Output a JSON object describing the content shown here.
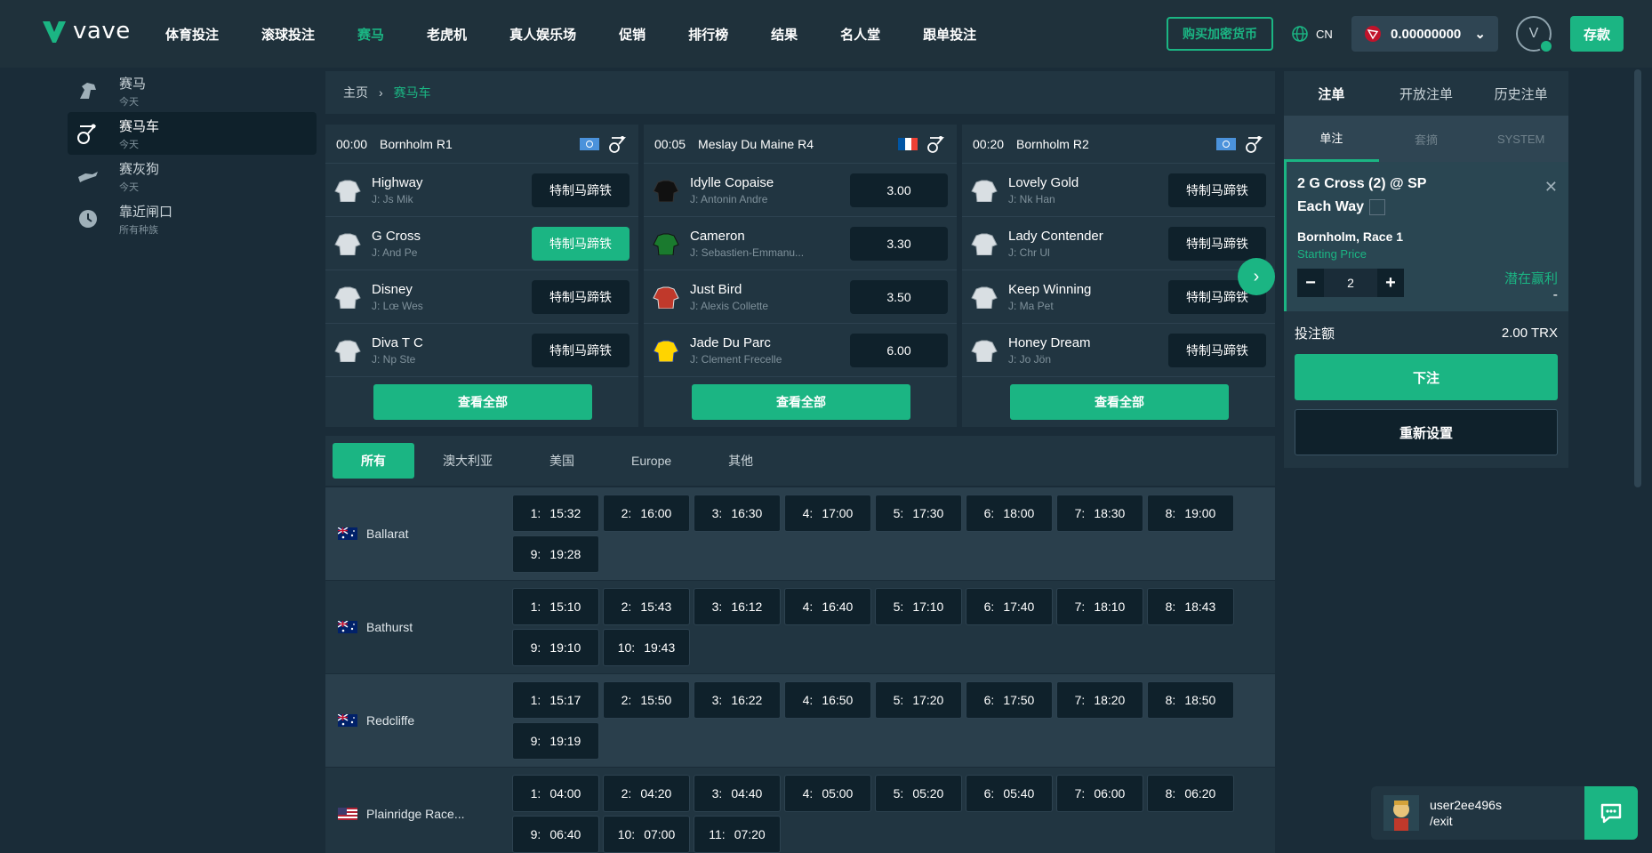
{
  "brand": {
    "name": "vave"
  },
  "nav": [
    {
      "label": "体育投注",
      "active": false
    },
    {
      "label": "滚球投注",
      "active": false
    },
    {
      "label": "赛马",
      "active": true
    },
    {
      "label": "老虎机",
      "active": false
    },
    {
      "label": "真人娱乐场",
      "active": false
    },
    {
      "label": "促销",
      "active": false
    },
    {
      "label": "排行榜",
      "active": false
    },
    {
      "label": "结果",
      "active": false
    },
    {
      "label": "名人堂",
      "active": false
    },
    {
      "label": "跟单投注",
      "active": false
    }
  ],
  "header": {
    "buy_crypto": "购买加密货币",
    "lang": "CN",
    "balance": "0.00000000",
    "avatar_letter": "V",
    "deposit": "存款"
  },
  "sidebar": [
    {
      "title": "赛马",
      "sub": "今天",
      "icon": "horse-icon"
    },
    {
      "title": "赛马车",
      "sub": "今天",
      "icon": "harness-icon"
    },
    {
      "title": "赛灰狗",
      "sub": "今天",
      "icon": "greyhound-icon"
    },
    {
      "title": "靠近闸口",
      "sub": "所有种族",
      "icon": "clock-icon"
    }
  ],
  "breadcrumb": {
    "home": "主页",
    "current": "赛马车"
  },
  "races": [
    {
      "time": "00:00",
      "name": "Bornholm R1",
      "flag": "un",
      "runners": [
        {
          "name": "Highway",
          "jockey": "J: Js Mik",
          "odds": "特制马蹄铁",
          "selected": false
        },
        {
          "name": "G Cross",
          "jockey": "J: And Pe",
          "odds": "特制马蹄铁",
          "selected": true
        },
        {
          "name": "Disney",
          "jockey": "J: Lœ Wes",
          "odds": "特制马蹄铁",
          "selected": false
        },
        {
          "name": "Diva T C",
          "jockey": "J: Np Ste",
          "odds": "特制马蹄铁",
          "selected": false
        }
      ]
    },
    {
      "time": "00:05",
      "name": "Meslay Du Maine R4",
      "flag": "fr",
      "runners": [
        {
          "name": "Idylle Copaise",
          "jockey": "J: Antonin Andre",
          "odds": "3.00",
          "selected": false
        },
        {
          "name": "Cameron",
          "jockey": "J: Sebastien-Emmanu...",
          "odds": "3.30",
          "selected": false
        },
        {
          "name": "Just Bird",
          "jockey": "J: Alexis Collette",
          "odds": "3.50",
          "selected": false
        },
        {
          "name": "Jade Du Parc",
          "jockey": "J: Clement Frecelle",
          "odds": "6.00",
          "selected": false
        }
      ]
    },
    {
      "time": "00:20",
      "name": "Bornholm R2",
      "flag": "un",
      "runners": [
        {
          "name": "Lovely Gold",
          "jockey": "J: Nk Han",
          "odds": "特制马蹄铁",
          "selected": false
        },
        {
          "name": "Lady Contender",
          "jockey": "J: Chr Ul",
          "odds": "特制马蹄铁",
          "selected": false
        },
        {
          "name": "Keep Winning",
          "jockey": "J: Ma Pet",
          "odds": "特制马蹄铁",
          "selected": false
        },
        {
          "name": "Honey Dream",
          "jockey": "J: Jo Jön",
          "odds": "特制马蹄铁",
          "selected": false
        }
      ]
    }
  ],
  "view_all": "查看全部",
  "regions": [
    {
      "label": "所有",
      "active": true
    },
    {
      "label": "澳大利亚",
      "active": false
    },
    {
      "label": "美国",
      "active": false
    },
    {
      "label": "Europe",
      "active": false
    },
    {
      "label": "其他",
      "active": false
    }
  ],
  "tracks": [
    {
      "name": "Ballarat",
      "flag": "au",
      "slots": [
        [
          "1:",
          "15:32"
        ],
        [
          "2:",
          "16:00"
        ],
        [
          "3:",
          "16:30"
        ],
        [
          "4:",
          "17:00"
        ],
        [
          "5:",
          "17:30"
        ],
        [
          "6:",
          "18:00"
        ],
        [
          "7:",
          "18:30"
        ],
        [
          "8:",
          "19:00"
        ],
        [
          "9:",
          "19:28"
        ]
      ]
    },
    {
      "name": "Bathurst",
      "flag": "au",
      "slots": [
        [
          "1:",
          "15:10"
        ],
        [
          "2:",
          "15:43"
        ],
        [
          "3:",
          "16:12"
        ],
        [
          "4:",
          "16:40"
        ],
        [
          "5:",
          "17:10"
        ],
        [
          "6:",
          "17:40"
        ],
        [
          "7:",
          "18:10"
        ],
        [
          "8:",
          "18:43"
        ],
        [
          "9:",
          "19:10"
        ],
        [
          "10:",
          "19:43"
        ]
      ]
    },
    {
      "name": "Redcliffe",
      "flag": "au",
      "slots": [
        [
          "1:",
          "15:17"
        ],
        [
          "2:",
          "15:50"
        ],
        [
          "3:",
          "16:22"
        ],
        [
          "4:",
          "16:50"
        ],
        [
          "5:",
          "17:20"
        ],
        [
          "6:",
          "17:50"
        ],
        [
          "7:",
          "18:20"
        ],
        [
          "8:",
          "18:50"
        ],
        [
          "9:",
          "19:19"
        ]
      ]
    },
    {
      "name": "Plainridge Race...",
      "flag": "us",
      "slots": [
        [
          "1:",
          "04:00"
        ],
        [
          "2:",
          "04:20"
        ],
        [
          "3:",
          "04:40"
        ],
        [
          "4:",
          "05:00"
        ],
        [
          "5:",
          "05:20"
        ],
        [
          "6:",
          "05:40"
        ],
        [
          "7:",
          "06:00"
        ],
        [
          "8:",
          "06:20"
        ],
        [
          "9:",
          "06:40"
        ],
        [
          "10:",
          "07:00"
        ],
        [
          "11:",
          "07:20"
        ]
      ]
    }
  ],
  "betslip": {
    "tabs": [
      "注单",
      "开放注单",
      "历史注单"
    ],
    "subtabs": [
      "单注",
      "套摘",
      "SYSTEM"
    ],
    "bet_title": "2 G Cross (2) @  SP",
    "each_way": "Each Way",
    "race": "Bornholm, Race 1",
    "price_type": "Starting Price",
    "stake_value": "2",
    "potential_label": "潜在赢利",
    "potential_value": "-",
    "stake_label": "投注额",
    "stake_amount": "2.00 TRX",
    "place": "下注",
    "reset": "重新设置"
  },
  "chat": {
    "user": "user2ee496s",
    "exit": "/exit"
  },
  "colors": {
    "accent": "#1bb583",
    "bg": "#1a2c38",
    "panel": "#213541"
  }
}
